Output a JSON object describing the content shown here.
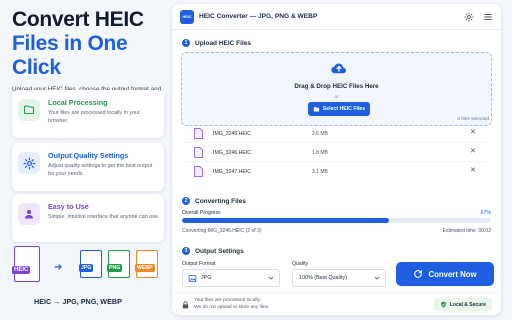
{
  "hero": {
    "line1": "Convert HEIC",
    "line2": "Files in One Click",
    "subtitle": "Upload your HEIC files, choose the output format and convert instantly with high quality."
  },
  "features": [
    {
      "title": "Local Processing",
      "desc": "Your files are processed locally in your browser.",
      "icon": "folder-icon",
      "color": "#239a4e"
    },
    {
      "title": "Output Quality Settings",
      "desc": "Adjust quality settings to get the best output for your needs.",
      "icon": "gear-icon",
      "color": "#1d5fe0"
    },
    {
      "title": "Easy to Use",
      "desc": "Simple, intuitive interface that anyone can use.",
      "icon": "user-icon",
      "color": "#7a43d6"
    }
  ],
  "formats": {
    "source": "HEIC",
    "targets": [
      "JPG",
      "PNG",
      "WEBP"
    ],
    "target_colors": [
      "#1d5fe0",
      "#239a4e",
      "#f08a1c"
    ],
    "caption": "HEIC → JPG, PNG, WEBP"
  },
  "app": {
    "logo_text": "HEIC",
    "title": "HEIC Converter — JPG, PNG & WEBP",
    "settings_icon": "gear-icon",
    "menu_icon": "hamburger-icon"
  },
  "upload": {
    "step_num": "1",
    "step_label": "Upload HEIC Files",
    "drop_text": "Drag & Drop HEIC Files Here",
    "or_text": "or",
    "select_button": "Select HEIC Files",
    "files_count": "3 files selected",
    "files": [
      {
        "name": "IMG_3245.HEIC",
        "size": "2.6 MB"
      },
      {
        "name": "IMG_3246.HEIC",
        "size": "1.8 MB"
      },
      {
        "name": "IMG_3247.HEIC",
        "size": "3.1 MB"
      }
    ],
    "remove_glyph": "✕"
  },
  "converting": {
    "step_num": "2",
    "step_label": "Converting Files",
    "progress_label": "Overall Progress",
    "progress_pct": "67%",
    "progress_value": 0.67,
    "status": "Converting IMG_3246.HEIC  (2 of 3)",
    "eta": "Estimated time: 00:02"
  },
  "output": {
    "step_num": "3",
    "step_label": "Output Settings",
    "format_label": "Output Format",
    "format_value": "JPG",
    "quality_label": "Quality",
    "quality_value": "100% (Best Quality)",
    "convert_button": "Convert Now"
  },
  "footer": {
    "note1": "Your files are processed locally.",
    "note2": "We do not upload or store any files.",
    "badge": "Local & Secure"
  },
  "colors": {
    "accent": "#1d5fe0",
    "green": "#239a4e",
    "purple": "#7a43d6"
  }
}
